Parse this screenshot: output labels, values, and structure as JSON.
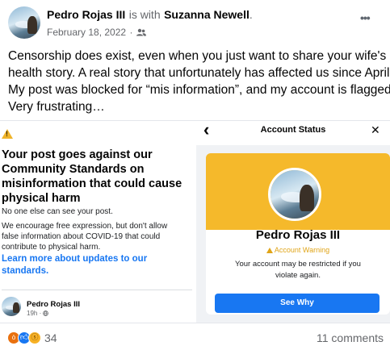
{
  "post": {
    "author": "Pedro Rojas III",
    "with_connector": "is with",
    "tagged": "Suzanna Newell",
    "tagged_suffix": ".",
    "date": "February 18, 2022",
    "date_sep": "·",
    "privacy_icon": "friends-icon",
    "more_label": "•••",
    "text_line1": "Censorship does exist, even when you just want to share your wife's",
    "text_line2": "health story. A real story that unfortunately has affected us since April.",
    "text_line3": "My post was blocked for “mis information”, and my account is flagged.",
    "text_line4": "Very frustrating…"
  },
  "left_panel": {
    "warning_icon": "warning-triangle-icon",
    "title_line1": "Your post goes against our",
    "title_line2": "Community Standards on",
    "title_line3": "misinformation that could cause",
    "title_line4": "physical harm",
    "no_one": "No one else can see your post.",
    "body_line1": "We encourage free expression, but don't allow",
    "body_line2": "false information about COVID-19 that could",
    "body_line3": "contribute to physical harm.",
    "link_line1": "Learn more about updates to our",
    "link_line2": "standards.",
    "author": "Pedro Rojas III",
    "time": "19h ·",
    "globe_icon": "globe-icon"
  },
  "right_panel": {
    "back_icon": "‹",
    "title": "Account Status",
    "close_icon": "✕",
    "name": "Pedro Rojas III",
    "warning_label": "Account Warning",
    "desc_line1": "Your account may be restricted if you",
    "desc_line2": "violate again.",
    "button_label": "See Why",
    "banner_color": "#f5b92b"
  },
  "footer": {
    "reactions": [
      "angry-icon",
      "like-icon",
      "sad-icon"
    ],
    "reaction_count": "34",
    "comments": "11 comments"
  }
}
